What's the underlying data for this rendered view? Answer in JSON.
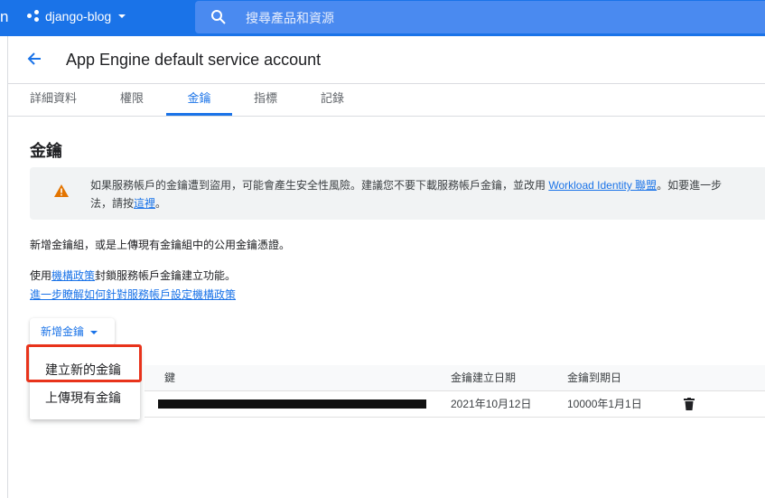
{
  "topbar": {
    "brand_fragment": "n",
    "project_name": "django-blog",
    "search_placeholder": "搜尋產品和資源",
    "color": "#1a73e8"
  },
  "page": {
    "title": "App Engine default service account",
    "tabs": [
      {
        "label": "詳細資料",
        "active": false
      },
      {
        "label": "權限",
        "active": false
      },
      {
        "label": "金鑰",
        "active": true
      },
      {
        "label": "指標",
        "active": false
      },
      {
        "label": "記錄",
        "active": false
      }
    ]
  },
  "keys": {
    "section_title": "金鑰",
    "warning": {
      "text_before": "如果服務帳戶的金鑰遭到盜用，可能會產生安全性風險。建議您不要下載服務帳戶金鑰，並改用 ",
      "link1": "Workload Identity 聯盟",
      "text_middle": "。如要進一步",
      "line2_before": "法，請按",
      "link2": "這裡",
      "line2_after": "。"
    },
    "description": "新增金鑰組，或是上傳現有金鑰組中的公用金鑰憑證。",
    "policy_prefix": "使用",
    "policy_link": "機構政策",
    "policy_suffix": "封鎖服務帳戶金鑰建立功能。",
    "learn_more_link": "進一步瞭解如何針對服務帳戶設定機構政策",
    "add_key_label": "新增金鑰",
    "menu_items": [
      "建立新的金鑰",
      "上傳現有金鑰"
    ]
  },
  "table": {
    "headers": {
      "key": "鍵",
      "created": "金鑰建立日期",
      "expires": "金鑰到期日"
    },
    "rows": [
      {
        "created": "2021年10月12日",
        "expires": "10000年1月1日"
      }
    ]
  }
}
